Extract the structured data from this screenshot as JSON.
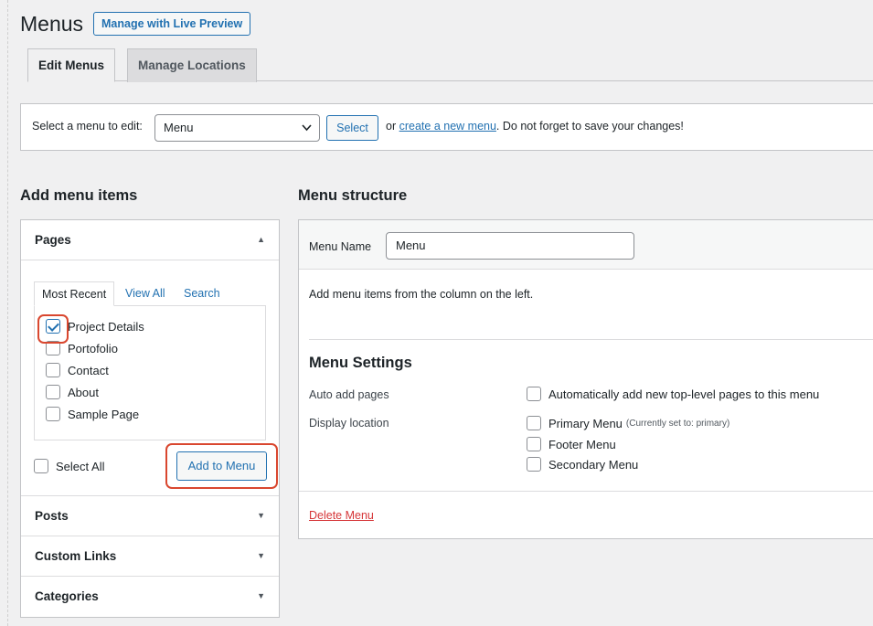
{
  "header": {
    "title": "Menus",
    "live_preview_label": "Manage with Live Preview"
  },
  "tabs": [
    {
      "label": "Edit Menus",
      "active": true
    },
    {
      "label": "Manage Locations",
      "active": false
    }
  ],
  "select_bar": {
    "label": "Select a menu to edit:",
    "selected_menu": "Menu",
    "select_button": "Select",
    "help_prefix": "or",
    "create_link": "create a new menu",
    "help_suffix": ". Do not forget to save your changes!"
  },
  "add_items": {
    "title": "Add menu items",
    "panels": [
      {
        "label": "Pages",
        "expanded": true
      },
      {
        "label": "Posts",
        "expanded": false
      },
      {
        "label": "Custom Links",
        "expanded": false
      },
      {
        "label": "Categories",
        "expanded": false
      }
    ],
    "inner_tabs": [
      "Most Recent",
      "View All",
      "Search"
    ],
    "pages": [
      {
        "label": "Project Details",
        "checked": true
      },
      {
        "label": "Portofolio",
        "checked": false
      },
      {
        "label": "Contact",
        "checked": false
      },
      {
        "label": "About",
        "checked": false
      },
      {
        "label": "Sample Page",
        "checked": false
      }
    ],
    "select_all_label": "Select All",
    "add_button_label": "Add to Menu"
  },
  "structure": {
    "title": "Menu structure",
    "menu_name_label": "Menu Name",
    "menu_name_value": "Menu",
    "hint": "Add menu items from the column on the left.",
    "settings_title": "Menu Settings",
    "auto_add_label": "Auto add pages",
    "auto_add_option": "Automatically add new top-level pages to this menu",
    "display_location_label": "Display location",
    "locations": [
      {
        "label": "Primary Menu",
        "note": "(Currently set to: primary)"
      },
      {
        "label": "Footer Menu",
        "note": ""
      },
      {
        "label": "Secondary Menu",
        "note": ""
      }
    ],
    "delete_label": "Delete Menu"
  },
  "colors": {
    "accent": "#2271b1",
    "highlight": "#d9472f",
    "danger": "#d63638"
  }
}
